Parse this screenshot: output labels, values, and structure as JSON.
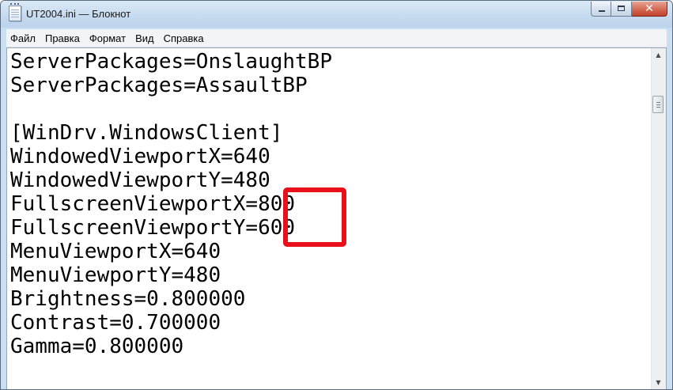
{
  "window": {
    "title": "UT2004.ini — Блокнот",
    "close_glyph": "✕",
    "icon": "notepad-icon"
  },
  "menu": [
    "Файл",
    "Правка",
    "Формат",
    "Вид",
    "Справка"
  ],
  "document": {
    "lines": [
      "ServerPackages=OnslaughtBP",
      "ServerPackages=AssaultBP",
      "",
      "[WinDrv.WindowsClient]",
      "WindowedViewportX=640",
      "WindowedViewportY=480",
      "FullscreenViewportX=800",
      "FullscreenViewportY=600",
      "MenuViewportX=640",
      "MenuViewportY=480",
      "Brightness=0.800000",
      "Contrast=0.700000",
      "Gamma=0.800000"
    ]
  },
  "scrollbar": {
    "up_arrow": "▲",
    "down_arrow": "▼"
  },
  "colors": {
    "highlight": "#e8101a",
    "title_bar": "#c5daf0",
    "close_button": "#c0402a"
  }
}
